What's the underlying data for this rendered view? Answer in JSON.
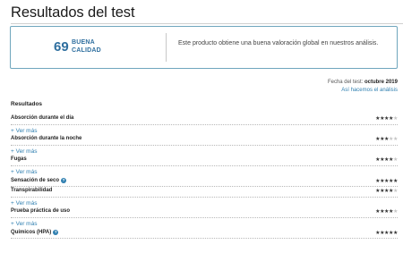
{
  "title": "Resultados del test",
  "score": {
    "number": "69",
    "label_line1": "BUENA",
    "label_line2": "CALIDAD",
    "summary": "Este producto obtiene una buena valoración global en nuestros análisis."
  },
  "test_date": {
    "label": "Fecha del test:",
    "value": "octubre 2019",
    "link": "Así hacemos el análisis"
  },
  "results_heading": "Resultados",
  "more_label": "+ Ver más",
  "results": [
    {
      "label": "Absorción durante el día",
      "stars": 4,
      "info": false
    },
    {
      "label": "Absorción durante la noche",
      "stars": 3,
      "info": false
    },
    {
      "label": "Fugas",
      "stars": 4,
      "info": false
    },
    {
      "label": "Sensación de seco",
      "stars": 5,
      "info": true
    },
    {
      "label": "Transpirabilidad",
      "stars": 4,
      "info": false
    },
    {
      "label": "Prueba práctica de uso",
      "stars": 4,
      "info": false
    },
    {
      "label": "Químicos (HPA)",
      "stars": 5,
      "info": true
    }
  ],
  "results_more_after": [
    true,
    true,
    true,
    false,
    true,
    true,
    false
  ],
  "max_stars": 5,
  "colors": {
    "accent": "#2f7fb0",
    "card_border": "#6fa6bd",
    "score": "#2f6f9f"
  }
}
